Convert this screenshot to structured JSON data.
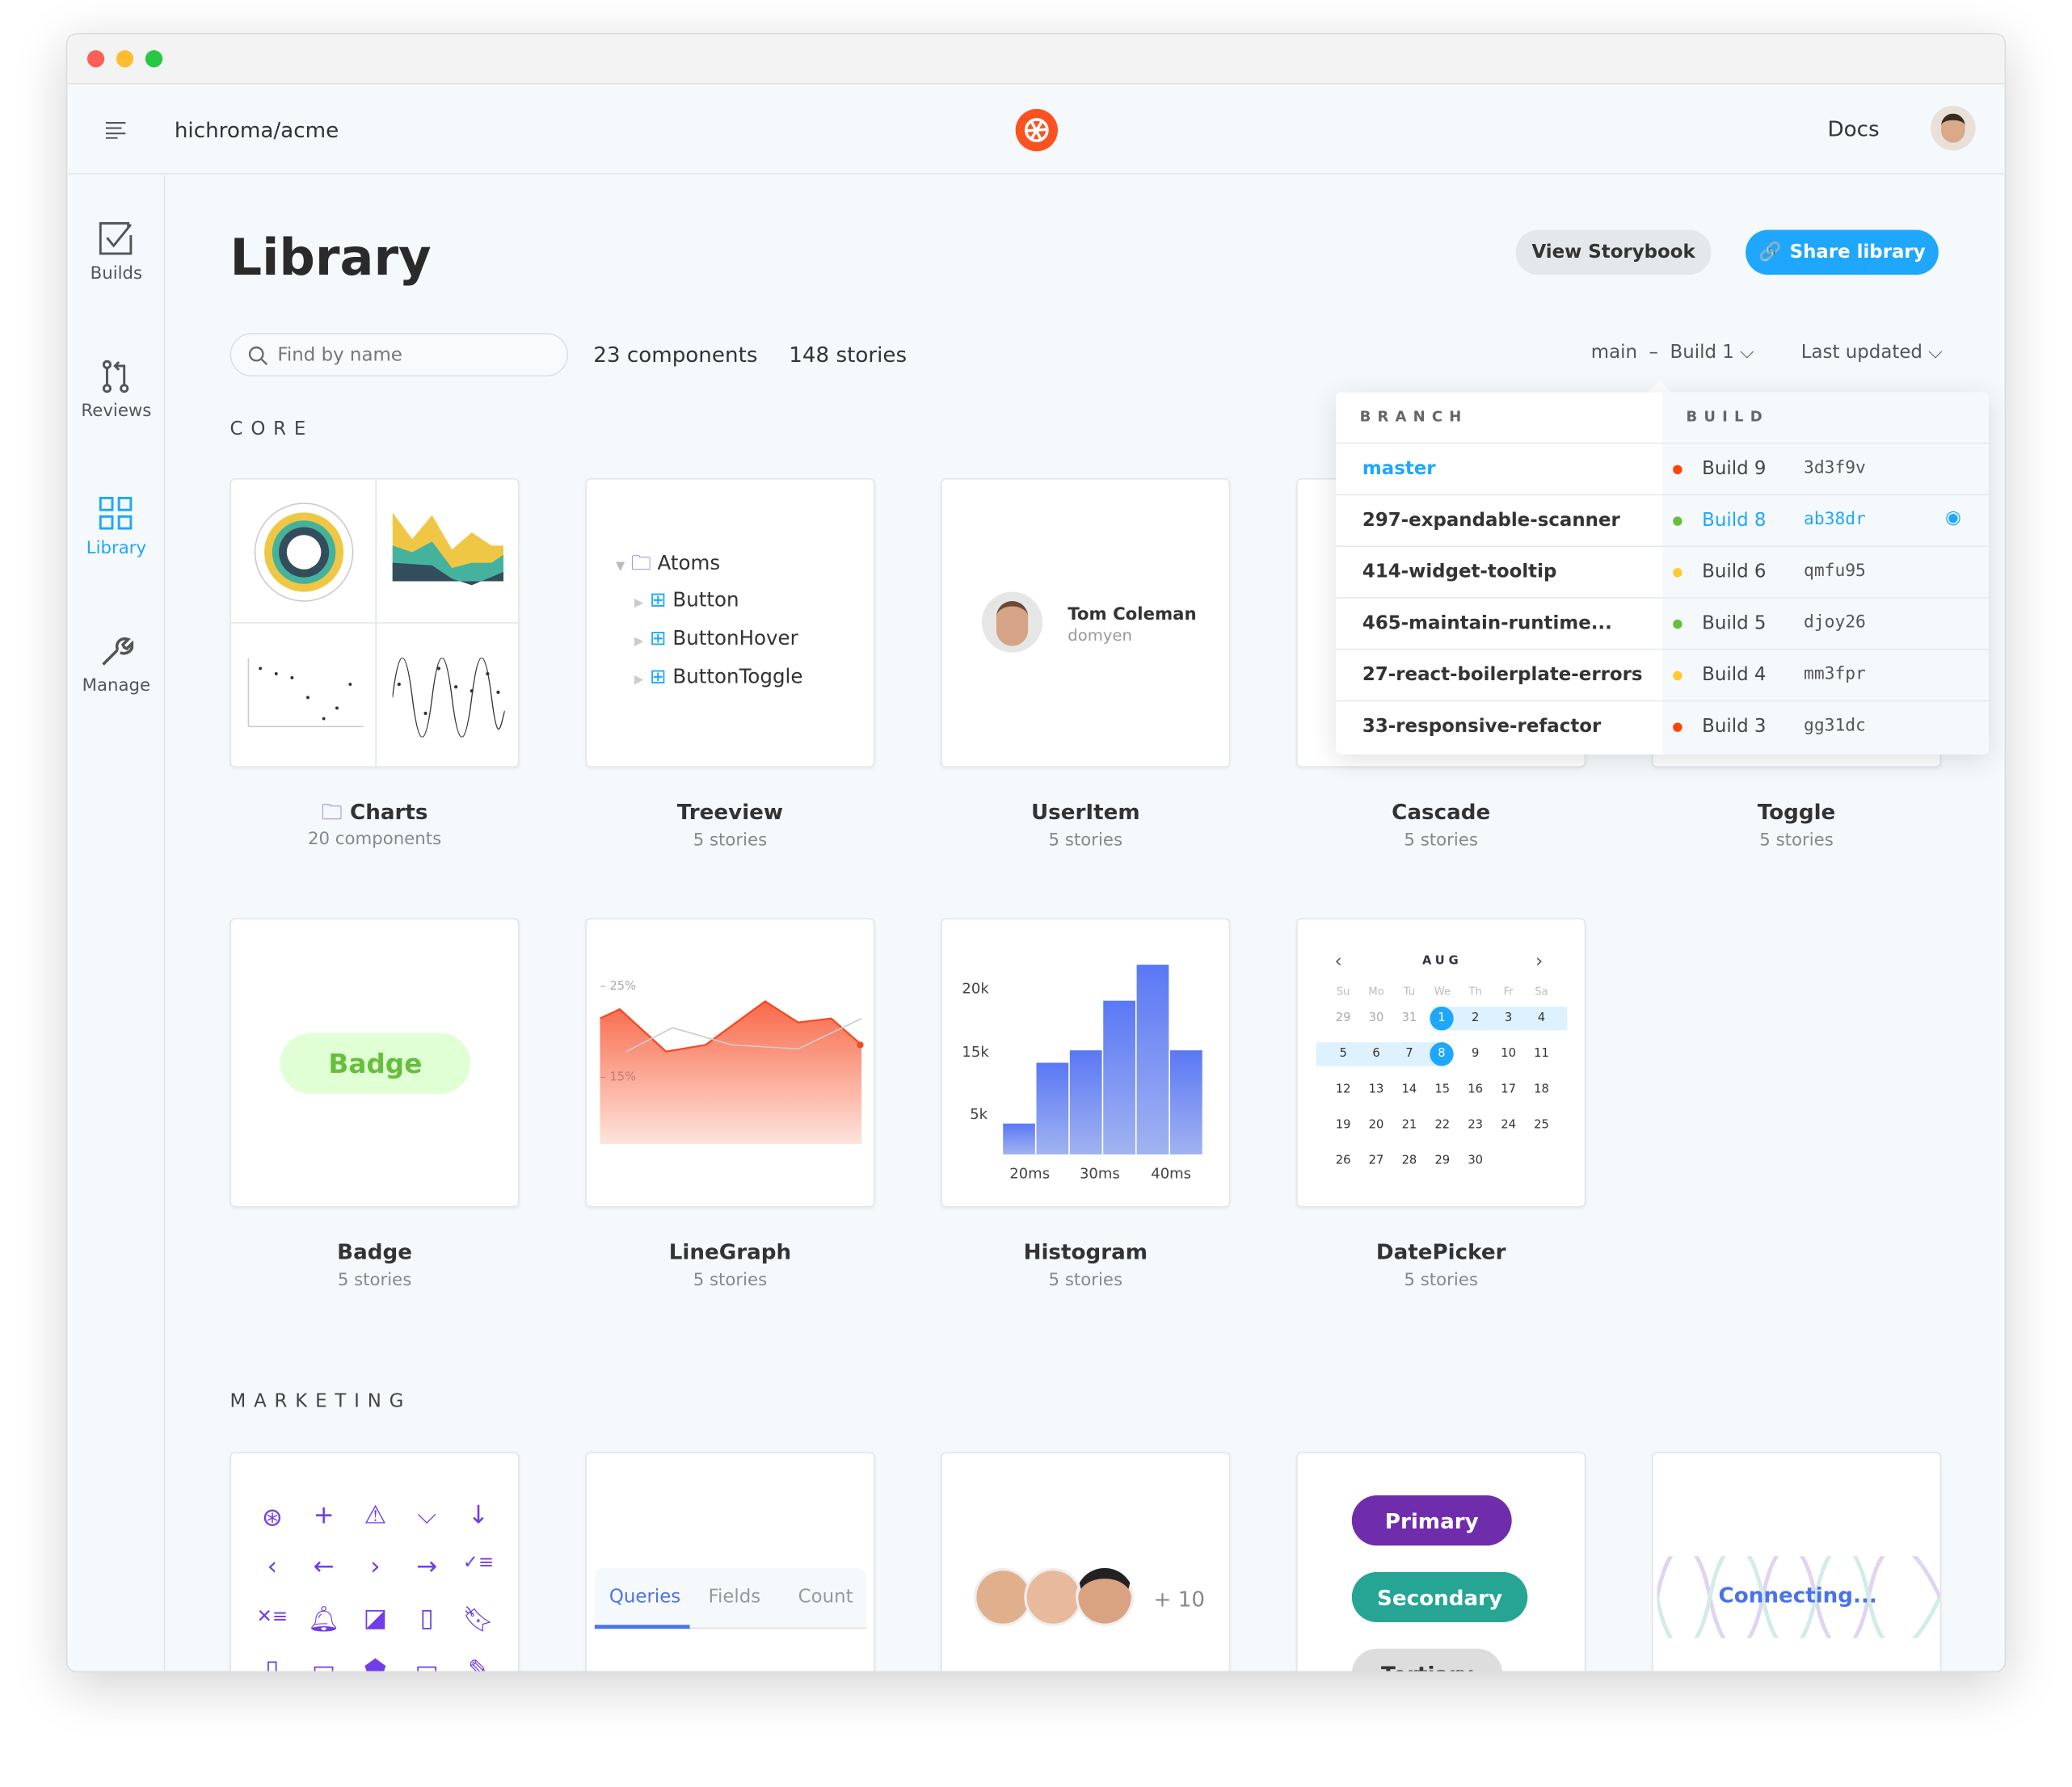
{
  "header": {
    "repo": "hichroma/acme",
    "docs": "Docs"
  },
  "sidebar": {
    "items": [
      {
        "label": "Builds",
        "icon": "check-square-icon"
      },
      {
        "label": "Reviews",
        "icon": "pull-request-icon"
      },
      {
        "label": "Library",
        "icon": "grid-icon",
        "active": true
      },
      {
        "label": "Manage",
        "icon": "wrench-icon"
      }
    ]
  },
  "page": {
    "title": "Library",
    "view_storybook": "View Storybook",
    "share_library": "Share library",
    "search_placeholder": "Find by name",
    "components_count": "23 components",
    "stories_count": "148 stories",
    "branch": "main",
    "dash": "–",
    "build": "Build 1",
    "sort": "Last updated"
  },
  "sections": {
    "core": "CORE",
    "marketing": "MARKETING"
  },
  "colors": {
    "accent": "#1ea7fd",
    "passed": "#66bf3c",
    "pending": "#ffc933",
    "failed": "#ff4400",
    "primary": "#6f2dac",
    "secondary": "#26a594"
  },
  "dropdown": {
    "branch_header": "BRANCH",
    "build_header": "BUILD",
    "rows": [
      {
        "branch": "master",
        "build": "Build 9",
        "hash": "3d3f9v",
        "status": "failed",
        "selected_branch": true
      },
      {
        "branch": "297-expandable-scanner",
        "build": "Build 8",
        "hash": "ab38dr",
        "status": "passed",
        "selected_build": true
      },
      {
        "branch": "414-widget-tooltip",
        "build": "Build 6",
        "hash": "qmfu95",
        "status": "pending"
      },
      {
        "branch": "465-maintain-runtime...",
        "build": "Build 5",
        "hash": "djoy26",
        "status": "passed"
      },
      {
        "branch": "27-react-boilerplate-errors",
        "build": "Build 4",
        "hash": "mm3fpr",
        "status": "pending"
      },
      {
        "branch": "33-responsive-refactor",
        "build": "Build 3",
        "hash": "gg31dc",
        "status": "failed"
      }
    ]
  },
  "cards": {
    "charts": {
      "title": "Charts",
      "sub": "20 components"
    },
    "treeview": {
      "title": "Treeview",
      "sub": "5 stories",
      "root": "Atoms",
      "items": [
        "Button",
        "ButtonHover",
        "ButtonToggle"
      ]
    },
    "useritem": {
      "title": "UserItem",
      "sub": "5 stories",
      "name": "Tom Coleman",
      "handle": "domyen"
    },
    "cascade": {
      "title": "Cascade",
      "sub": "5 stories"
    },
    "toggle": {
      "title": "Toggle",
      "sub": "5 stories"
    },
    "badge": {
      "title": "Badge",
      "sub": "5 stories",
      "label": "Badge"
    },
    "linegraph": {
      "title": "LineGraph",
      "sub": "5 stories",
      "tick_high": "25%",
      "tick_low": "15%"
    },
    "histogram": {
      "title": "Histogram",
      "sub": "5 stories",
      "yticks": [
        "20k",
        "15k",
        "5k"
      ],
      "xticks": [
        "20ms",
        "30ms",
        "40ms"
      ],
      "values": [
        2500,
        7400,
        8400,
        12400,
        15300,
        8400
      ]
    },
    "datepicker": {
      "title": "DatePicker",
      "sub": "5 stories",
      "month": "AUG",
      "weekdays": [
        "Su",
        "Mo",
        "Tu",
        "We",
        "Th",
        "Fr",
        "Sa"
      ],
      "weeks": [
        [
          "29",
          "30",
          "31",
          "1",
          "2",
          "3",
          "4"
        ],
        [
          "5",
          "6",
          "7",
          "8",
          "9",
          "10",
          "11"
        ],
        [
          "12",
          "13",
          "14",
          "15",
          "16",
          "17",
          "18"
        ],
        [
          "19",
          "20",
          "21",
          "22",
          "23",
          "24",
          "25"
        ],
        [
          "26",
          "27",
          "28",
          "29",
          "30",
          "",
          ""
        ]
      ],
      "range_start": "1",
      "range_end": "8"
    },
    "tabs": {
      "items": [
        "Queries",
        "Fields",
        "Count"
      ],
      "active": "Queries"
    },
    "avatars": {
      "more": "+ 10"
    },
    "buttons": {
      "primary": "Primary",
      "secondary": "Secondary",
      "tertiary": "Tertiary"
    },
    "connecting": {
      "label": "Connecting..."
    }
  }
}
